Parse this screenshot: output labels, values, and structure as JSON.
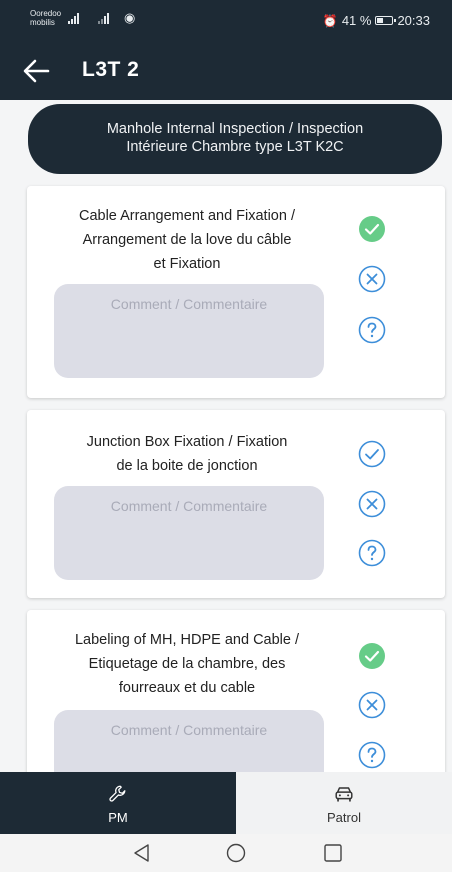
{
  "status_bar": {
    "carrier_line1": "Ooredoo",
    "carrier_line2": "mobilis",
    "network": "4G",
    "battery_text": "41 %",
    "time": "20:33"
  },
  "app_bar": {
    "title": "L3T 2",
    "back_icon": "arrow-left-icon"
  },
  "banner": {
    "line1": "Manhole Internal Inspection / Inspection",
    "line2": "Intérieure Chambre type L3T K2C"
  },
  "comment_placeholder": "Comment / Commentaire",
  "checklist": [
    {
      "title_lines": [
        "Cable Arrangement and Fixation /",
        "Arrangement de la love du câble",
        "et Fixation"
      ],
      "status": "ok"
    },
    {
      "title_lines": [
        "Junction Box Fixation / Fixation",
        "de la boite de jonction"
      ],
      "status": "none"
    },
    {
      "title_lines": [
        "Labeling of MH, HDPE and Cable /",
        "Etiquetage de la chambre, des",
        "fourreaux et du cable"
      ],
      "status": "ok"
    }
  ],
  "colors": {
    "primary_dark": "#1d2a35",
    "accent_blue": "#3d8ed9",
    "ok_green": "#66cc88",
    "comment_bg": "#dcdde6"
  },
  "bottom_nav": {
    "items": [
      {
        "label": "PM",
        "icon": "wrench-icon",
        "active": true
      },
      {
        "label": "Patrol",
        "icon": "car-icon",
        "active": false
      }
    ]
  }
}
